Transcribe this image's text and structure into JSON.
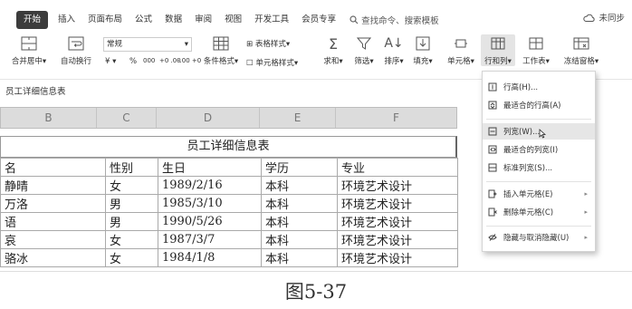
{
  "tabs": [
    "开始",
    "插入",
    "页面布局",
    "公式",
    "数据",
    "审阅",
    "视图",
    "开发工具",
    "会员专享"
  ],
  "search_placeholder": "查找命令、搜索模板",
  "sync_status": "未同步",
  "ribbon": {
    "merge": "合并居中",
    "wrap": "自动换行",
    "font_name": "常规",
    "currency": "¥",
    "percent": "%",
    "thousands": "000",
    "dec_inc": "+0 .00",
    "dec_dec": "-.00 +0",
    "cond_format": "条件格式",
    "table_style": "表格样式",
    "cell_style": "单元格样式",
    "sum": "求和",
    "filter": "筛选",
    "sort": "排序",
    "fill": "填充",
    "cell": "单元格",
    "row_col": "行和列",
    "sheet": "工作表",
    "freeze": "冻结窗格"
  },
  "formula_text": "员工详细信息表",
  "columns": [
    "B",
    "C",
    "D",
    "E",
    "F"
  ],
  "title": "员工详细信息表",
  "rows": [
    [
      "名",
      "性别",
      "生日",
      "学历",
      "专业"
    ],
    [
      "静晴",
      "女",
      "1989/2/16",
      "本科",
      "环境艺术设计"
    ],
    [
      "万洛",
      "男",
      "1985/3/10",
      "本科",
      "环境艺术设计"
    ],
    [
      "语",
      "男",
      "1990/5/26",
      "本科",
      "环境艺术设计"
    ],
    [
      "哀",
      "女",
      "1987/3/7",
      "本科",
      "环境艺术设计"
    ],
    [
      "骆冰",
      "女",
      "1984/1/8",
      "本科",
      "环境艺术设计"
    ]
  ],
  "menu": {
    "row_height": "行高(H)...",
    "best_row_height": "最适合的行高(A)",
    "col_width": "列宽(W)...",
    "best_col_width": "最适合的列宽(I)",
    "std_col_width": "标准列宽(S)...",
    "insert_cells": "插入单元格(E)",
    "delete_cells": "删除单元格(C)",
    "hide_show": "隐藏与取消隐藏(U)"
  },
  "caption": "图5-37",
  "colors": {
    "active_tab": "#3c3c3c",
    "header_bg": "#dcdcdc",
    "highlight": "#e6e6e6"
  }
}
